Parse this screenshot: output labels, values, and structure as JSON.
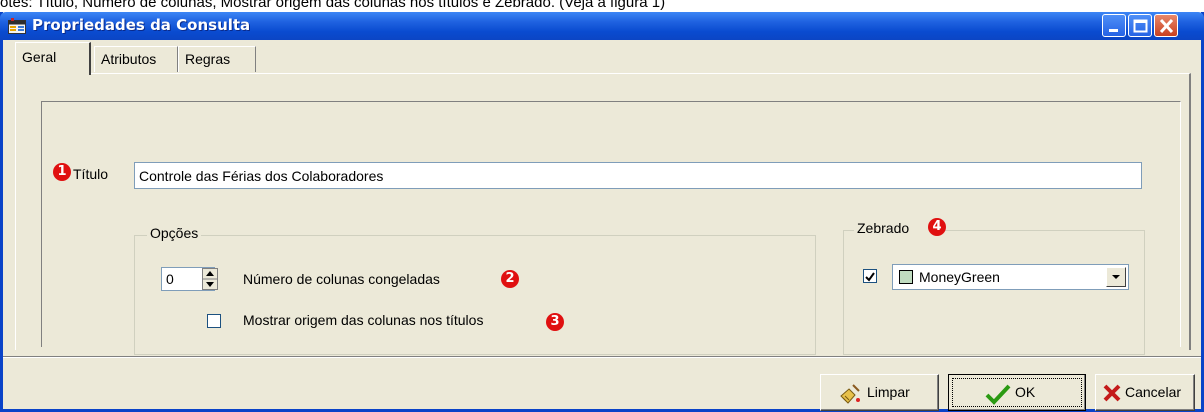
{
  "caption": "otes: Título, Número de colunas, Mostrar origem das colunas nos títulos e Zebrado. (Veja a figura 1)",
  "window": {
    "title": "Propriedades da Consulta",
    "icon": "app-window-icon",
    "controls": [
      "minimize-icon",
      "maximize-icon",
      "close-icon"
    ]
  },
  "tabs": [
    {
      "label": "Geral",
      "active": true
    },
    {
      "label": "Atributos",
      "active": false
    },
    {
      "label": "Regras",
      "active": false
    }
  ],
  "form": {
    "titulo_badge": "1",
    "titulo_label": "Título",
    "titulo_value": "Controle das Férias dos Colaboradores",
    "opcoes_legend": "Opções",
    "colunas_value": "0",
    "colunas_label": "Número de colunas congeladas",
    "colunas_badge": "2",
    "origem_checked": false,
    "origem_label": "Mostrar origem das colunas nos títulos",
    "origem_badge": "3",
    "zebrado_legend": "Zebrado",
    "zebrado_badge": "4",
    "zebrado_checked": true,
    "zebrado_color_name": "MoneyGreen",
    "zebrado_color_hex": "#c0dcc0"
  },
  "buttons": {
    "limpar": "Limpar",
    "ok": "OK",
    "cancelar": "Cancelar"
  },
  "colors": {
    "titlebar": "#0a4bd0",
    "dialog_bg": "#ece9d8",
    "badge": "#e01010",
    "ok_check": "#2a9a12",
    "cancel_x": "#c41a1a"
  }
}
